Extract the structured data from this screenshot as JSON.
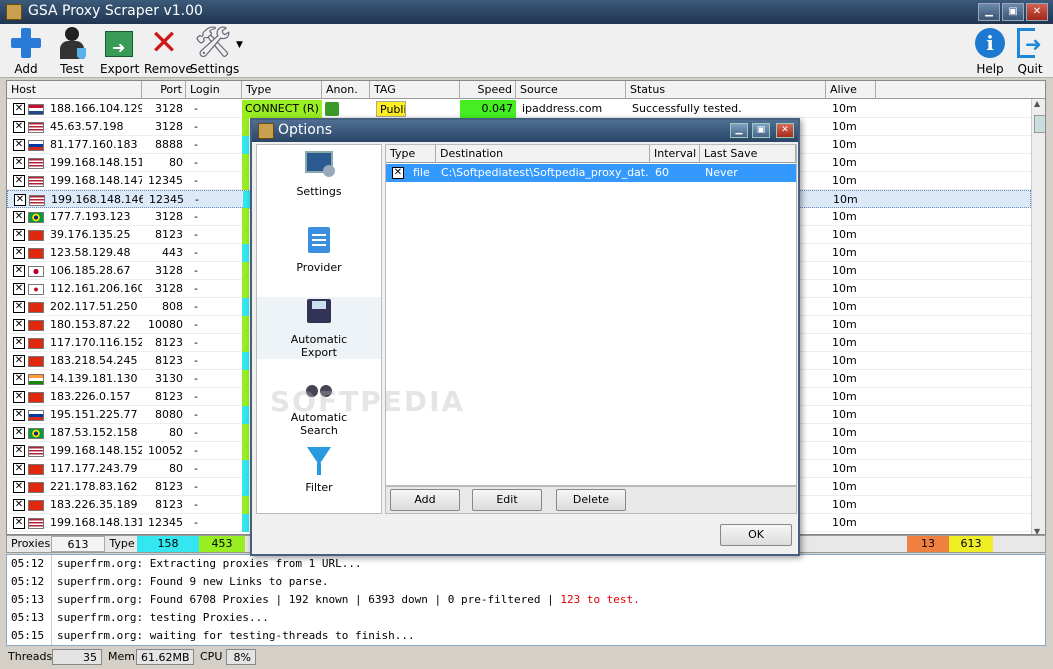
{
  "window": {
    "title": "GSA Proxy Scraper v1.00"
  },
  "toolbar": {
    "add": "Add",
    "test": "Test",
    "export": "Export",
    "remove": "Remove",
    "settings": "Settings",
    "help": "Help",
    "quit": "Quit"
  },
  "grid": {
    "columns": [
      "Host",
      "Port",
      "Login",
      "Type",
      "Anon.",
      "TAG",
      "Speed",
      "Source",
      "Status",
      "Alive"
    ],
    "first_row": {
      "type": "CONNECT (R)",
      "tag": "Public",
      "speed": "0.047",
      "source": "ipaddress.com",
      "status": "Successfully tested."
    },
    "rows": [
      {
        "host": "188.166.104.129",
        "port": "3128",
        "login": "-",
        "alive": "10m",
        "flag": "nl"
      },
      {
        "host": "45.63.57.198",
        "port": "3128",
        "login": "-",
        "alive": "10m",
        "flag": "us"
      },
      {
        "host": "81.177.160.183",
        "port": "8888",
        "login": "-",
        "alive": "10m",
        "flag": "ru"
      },
      {
        "host": "199.168.148.151",
        "port": "80",
        "login": "-",
        "alive": "10m",
        "flag": "us"
      },
      {
        "host": "199.168.148.147",
        "port": "12345",
        "login": "-",
        "alive": "10m",
        "flag": "us"
      },
      {
        "host": "199.168.148.146",
        "port": "12345",
        "login": "-",
        "alive": "10m",
        "flag": "us"
      },
      {
        "host": "177.7.193.123",
        "port": "3128",
        "login": "-",
        "alive": "10m",
        "flag": "br"
      },
      {
        "host": "39.176.135.25",
        "port": "8123",
        "login": "-",
        "alive": "10m",
        "flag": "cn"
      },
      {
        "host": "123.58.129.48",
        "port": "443",
        "login": "-",
        "alive": "10m",
        "flag": "cn"
      },
      {
        "host": "106.185.28.67",
        "port": "3128",
        "login": "-",
        "alive": "10m",
        "flag": "jp"
      },
      {
        "host": "112.161.206.160",
        "port": "3128",
        "login": "-",
        "alive": "10m",
        "flag": "kr"
      },
      {
        "host": "202.117.51.250",
        "port": "808",
        "login": "-",
        "alive": "10m",
        "flag": "cn"
      },
      {
        "host": "180.153.87.22",
        "port": "10080",
        "login": "-",
        "alive": "10m",
        "flag": "cn"
      },
      {
        "host": "117.170.116.152",
        "port": "8123",
        "login": "-",
        "alive": "10m",
        "flag": "cn"
      },
      {
        "host": "183.218.54.245",
        "port": "8123",
        "login": "-",
        "alive": "10m",
        "flag": "cn"
      },
      {
        "host": "14.139.181.130",
        "port": "3130",
        "login": "-",
        "alive": "10m",
        "flag": "in"
      },
      {
        "host": "183.226.0.157",
        "port": "8123",
        "login": "-",
        "alive": "10m",
        "flag": "cn"
      },
      {
        "host": "195.151.225.77",
        "port": "8080",
        "login": "-",
        "alive": "10m",
        "flag": "ru"
      },
      {
        "host": "187.53.152.158",
        "port": "80",
        "login": "-",
        "alive": "10m",
        "flag": "br"
      },
      {
        "host": "199.168.148.152",
        "port": "10052",
        "login": "-",
        "alive": "10m",
        "flag": "us"
      },
      {
        "host": "117.177.243.79",
        "port": "80",
        "login": "-",
        "alive": "10m",
        "flag": "cn"
      },
      {
        "host": "221.178.83.162",
        "port": "8123",
        "login": "-",
        "alive": "10m",
        "flag": "cn"
      },
      {
        "host": "183.226.35.189",
        "port": "8123",
        "login": "-",
        "alive": "10m",
        "flag": "cn"
      },
      {
        "host": "199.168.148.131",
        "port": "12345",
        "login": "-",
        "alive": "10m",
        "flag": "us"
      }
    ]
  },
  "stats": {
    "proxies_label": "Proxies",
    "proxies": "613",
    "type_label": "Type",
    "type_a": "158",
    "type_b": "453",
    "alive_a": "13",
    "alive_b": "613"
  },
  "log": [
    {
      "time": "05:12",
      "msg": "superfrm.org: Extracting proxies from 1 URL..."
    },
    {
      "time": "05:12",
      "msg": "superfrm.org: Found 9 new Links to parse."
    },
    {
      "time": "05:13",
      "msg": "superfrm.org: Found 6708 Proxies | 192 known | 6393 down | 0 pre-filtered | ",
      "red": "123 to test."
    },
    {
      "time": "05:13",
      "msg": "superfrm.org: testing Proxies..."
    },
    {
      "time": "05:15",
      "msg": "superfrm.org: waiting for testing-threads to finish..."
    }
  ],
  "statusbar": {
    "threads_label": "Threads",
    "threads": "35",
    "mem_label": "Mem",
    "mem": "61.62MB",
    "cpu_label": "CPU",
    "cpu": "8%"
  },
  "dialog": {
    "title": "Options",
    "side": [
      "Settings",
      "Provider",
      "Automatic Export",
      "Automatic Search",
      "Filter"
    ],
    "columns": [
      "Type",
      "Destination",
      "Interval",
      "Last Save"
    ],
    "row": {
      "type": "file",
      "destination": "C:\\Softpediatest\\Softpedia_proxy_dat...",
      "interval": "60",
      "last_save": "Never"
    },
    "buttons": {
      "add": "Add",
      "edit": "Edit",
      "delete": "Delete",
      "ok": "OK"
    }
  },
  "watermark": "SOFTPEDIA"
}
